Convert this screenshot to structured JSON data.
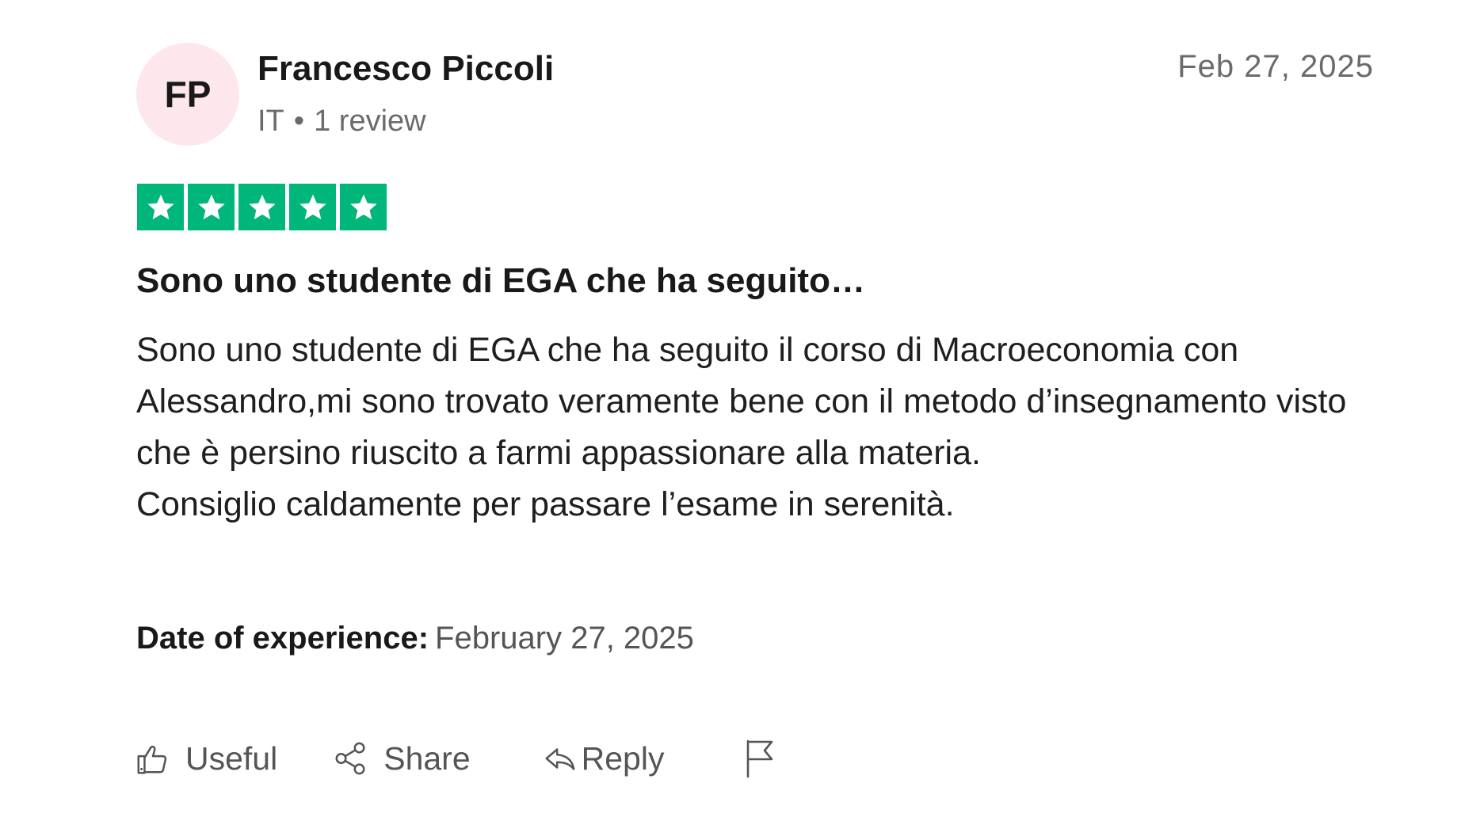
{
  "reviewer": {
    "initials": "FP",
    "name": "Francesco Piccoli",
    "country": "IT",
    "separator": "•",
    "review_count": "1 review",
    "avatar_bg": "#fde7ec"
  },
  "review": {
    "date": "Feb 27, 2025",
    "rating": 5,
    "rating_max": 5,
    "star_color": "#00b67a",
    "title": "Sono uno studente di EGA che ha seguito…",
    "body_line1": "Sono uno studente di EGA che ha seguito il corso di Macroeconomia con Alessandro,mi sono trovato veramente bene con il metodo d’insegnamento visto che è persino riuscito a farmi appassionare alla materia.",
    "body_line2": "Consiglio caldamente per passare l’esame in serenità.",
    "experience_label": "Date of experience:",
    "experience_date": "February 27, 2025"
  },
  "actions": {
    "useful_label": "Useful",
    "useful_icon": "thumbs-up-icon",
    "share_label": "Share",
    "share_icon": "share-icon",
    "reply_label": "Reply",
    "reply_icon": "reply-icon",
    "flag_icon": "flag-icon"
  }
}
